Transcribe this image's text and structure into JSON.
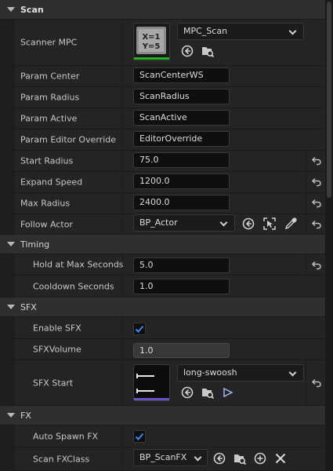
{
  "categories": {
    "scan": "Scan",
    "timing": "Timing",
    "sfx": "SFX",
    "fx": "FX"
  },
  "scan": {
    "scanner_mpc": {
      "label": "Scanner MPC",
      "thumb_line1": "X=1",
      "thumb_line2": "Y=5",
      "value": "MPC_Scan"
    },
    "param_center": {
      "label": "Param Center",
      "value": "ScanCenterWS"
    },
    "param_radius": {
      "label": "Param Radius",
      "value": "ScanRadius"
    },
    "param_active": {
      "label": "Param Active",
      "value": "ScanActive"
    },
    "param_editor_override": {
      "label": "Param Editor Override",
      "value": "EditorOverride"
    },
    "start_radius": {
      "label": "Start Radius",
      "value": "75.0"
    },
    "expand_speed": {
      "label": "Expand Speed",
      "value": "1200.0"
    },
    "max_radius": {
      "label": "Max Radius",
      "value": "2400.0"
    },
    "follow_actor": {
      "label": "Follow Actor",
      "value": "BP_Actor"
    }
  },
  "timing": {
    "hold_at_max": {
      "label": "Hold at Max Seconds",
      "value": "5.0"
    },
    "cooldown": {
      "label": "Cooldown Seconds",
      "value": "1.0"
    }
  },
  "sfx": {
    "enable_sfx": {
      "label": "Enable SFX",
      "checked": true
    },
    "sfx_volume": {
      "label": "SFXVolume",
      "value": "1.0"
    },
    "sfx_start": {
      "label": "SFX Start",
      "value": "long-swoosh"
    }
  },
  "fx": {
    "auto_spawn": {
      "label": "Auto Spawn FX",
      "checked": true
    },
    "scan_fx_class": {
      "label": "Scan FXClass",
      "value": "BP_ScanFX"
    }
  },
  "colors": {
    "panel_bg": "#242424",
    "category_bg": "#2f2f2f",
    "input_bg": "#0f0f0f",
    "checkbox_accent": "#2f8df5",
    "material_thumb_bar": "#1fb61f",
    "sound_thumb_bar": "#6a52c4"
  }
}
